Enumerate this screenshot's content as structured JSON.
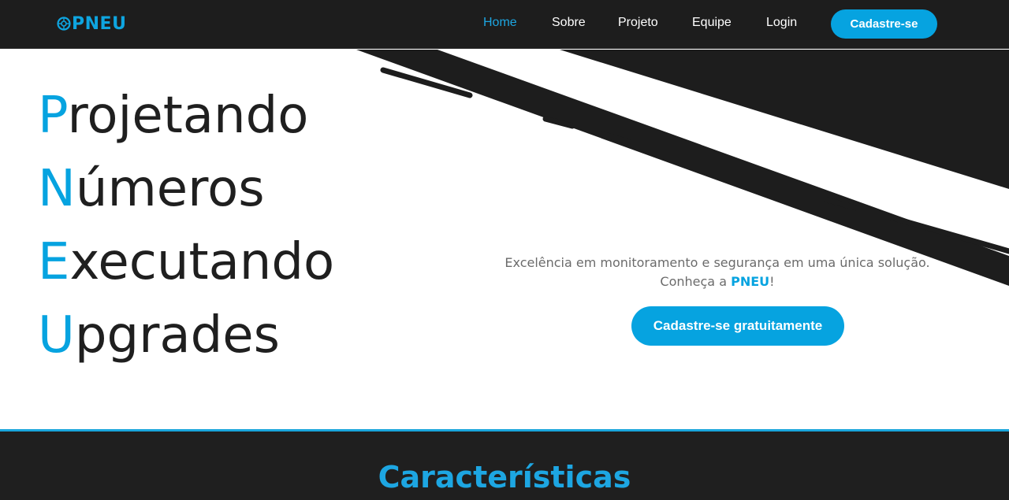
{
  "brand": {
    "logo_text": "PNEU",
    "logo_icon": "tire-icon"
  },
  "nav": {
    "links": [
      {
        "label": "Home",
        "active": true
      },
      {
        "label": "Sobre",
        "active": false
      },
      {
        "label": "Projeto",
        "active": false
      },
      {
        "label": "Equipe",
        "active": false
      },
      {
        "label": "Login",
        "active": false
      }
    ],
    "cta_label": "Cadastre-se"
  },
  "hero": {
    "acrostic": [
      {
        "initial": "P",
        "rest": "rojetando"
      },
      {
        "initial": "N",
        "rest": "úmeros"
      },
      {
        "initial": "E",
        "rest": "xecutando"
      },
      {
        "initial": "U",
        "rest": "pgrades"
      }
    ],
    "tagline_line1": "Excelência em monitoramento e segurança em uma única solução.",
    "tagline_prefix": "Conheça a ",
    "tagline_brand": "PNEU",
    "tagline_suffix": "!",
    "cta_label": "Cadastre-se gratuitamente"
  },
  "features": {
    "title": "Características"
  },
  "colors": {
    "accent": "#06a3e0",
    "dark": "#1d1d1d",
    "text": "#1f1f1f"
  }
}
